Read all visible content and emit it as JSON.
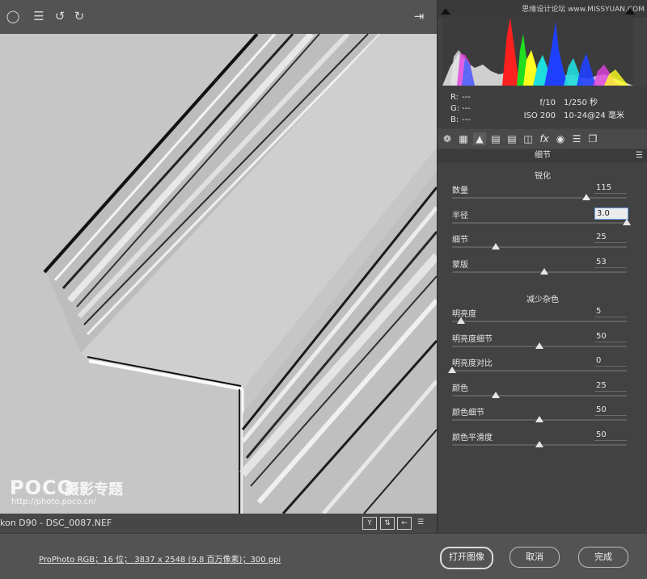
{
  "toolbar": {
    "icons": [
      "zoom-icon",
      "list-icon",
      "rotate-left-icon",
      "rotate-right-icon",
      "export-icon"
    ]
  },
  "preview": {
    "watermark_logo": "POCO",
    "watermark_title": "摄影专题",
    "watermark_url": "http://photo.poco.cn/"
  },
  "statusbar": {
    "filename": "kon D90 -  DSC_0087.NEF"
  },
  "right_panel": {
    "site_watermark": "思缘设计论坛  www.MISSYUAN.COM",
    "rgb": {
      "r_label": "R:",
      "r_value": "---",
      "g_label": "G:",
      "g_value": "---",
      "b_label": "B:",
      "b_value": "---"
    },
    "exif": {
      "aperture": "f/10",
      "shutter": "1/250 秒",
      "iso": "ISO 200",
      "lens": "10-24@24 毫米"
    },
    "panel_title": "细节",
    "sharpen": {
      "title": "锐化",
      "sliders": [
        {
          "label": "数量",
          "value": "115",
          "fraction": 0.77
        },
        {
          "label": "半径",
          "value": "3.0",
          "fraction": 1.0,
          "active": true
        },
        {
          "label": "细节",
          "value": "25",
          "fraction": 0.25
        },
        {
          "label": "蒙版",
          "value": "53",
          "fraction": 0.53
        }
      ]
    },
    "noise": {
      "title": "减少杂色",
      "sliders": [
        {
          "label": "明亮度",
          "value": "5",
          "fraction": 0.05
        },
        {
          "label": "明亮度细节",
          "value": "50",
          "fraction": 0.5
        },
        {
          "label": "明亮度对比",
          "value": "0",
          "fraction": 0.0
        },
        {
          "label": "颜色",
          "value": "25",
          "fraction": 0.25
        },
        {
          "label": "颜色细节",
          "value": "50",
          "fraction": 0.5
        },
        {
          "label": "颜色平滑度",
          "value": "50",
          "fraction": 0.5
        }
      ]
    }
  },
  "bottom": {
    "workflow": "ProPhoto RGB；16 位；  3837 x 2548 (9.8 百万像素)；300 ppi",
    "open_button": "打开图像",
    "cancel_button": "取消",
    "done_button": "完成"
  },
  "colors": {
    "panel": "#424242",
    "accent": "#6a9fe6"
  }
}
